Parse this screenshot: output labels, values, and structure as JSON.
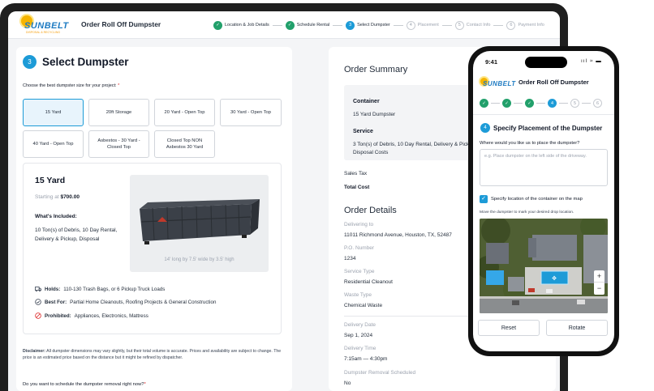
{
  "brand": {
    "name": "SUNBELT",
    "tagline": "DISPOSAL & RECYCLING"
  },
  "app_title": "Order Roll Off Dumpster",
  "steps": [
    {
      "num": "",
      "label": "Location & Job Details",
      "state": "done"
    },
    {
      "num": "",
      "label": "Schedule Rental",
      "state": "done"
    },
    {
      "num": "3",
      "label": "Select Dumpster",
      "state": "current"
    },
    {
      "num": "4",
      "label": "Placement",
      "state": "todo"
    },
    {
      "num": "5",
      "label": "Contact Info",
      "state": "todo"
    },
    {
      "num": "6",
      "label": "Payment Info",
      "state": "todo"
    }
  ],
  "select": {
    "step_num": "3",
    "title": "Select Dumpster",
    "prompt": "Choose the best dumpster size for your project:",
    "required_mark": "*",
    "options": [
      {
        "label": "15 Yard",
        "selected": true
      },
      {
        "label": "20ft Storage",
        "selected": false
      },
      {
        "label": "20 Yard - Open Top",
        "selected": false
      },
      {
        "label": "30 Yard - Open Top",
        "selected": false
      },
      {
        "label": "40 Yard - Open Top",
        "selected": false
      },
      {
        "label": "Asbestos - 30 Yard - Closed Top",
        "selected": false
      },
      {
        "label": "Closed Top NON Asbestos 30 Yard",
        "selected": false
      }
    ]
  },
  "detail": {
    "name": "15 Yard",
    "starting_prefix": "Starting at",
    "price": "$700.00",
    "included_heading": "What's Included:",
    "included_text": "10 Ton(s) of Debris, 10 Day Rental, Delivery & Pickup, Disposal",
    "dimensions": "14' long by 7.5' wide by 3.5' high",
    "holds_label": "Holds:",
    "holds_text": "110-130 Trash Bags, or 6 Pickup Truck Loads",
    "best_label": "Best For:",
    "best_text": "Partial Home Cleanouts, Roofing Projects & General Construction",
    "prohibited_label": "Prohibited:",
    "prohibited_text": "Appliances, Electronics, Mattress"
  },
  "disclaimer": {
    "label": "Disclaimer:",
    "text": "All dumpster dimensions may vary slightly, but their total volume is accurate. Prices and availability are subject to change. The price is an estimated price based on the distance but it might be refined by dispatcher."
  },
  "schedule_question": "Do you want to schedule the dumpster removal right now?",
  "order_summary": {
    "title": "Order Summary",
    "container_label": "Container",
    "container_value": "15 Yard Dumpster",
    "service_label": "Service",
    "service_value": "3 Ton(s) of Debris, 10 Day Rental, Delivery & Pickup, Disposal Costs",
    "sales_tax_label": "Sales Tax",
    "total_cost_label": "Total Cost"
  },
  "order_details": {
    "title": "Order Details",
    "rows": [
      {
        "label": "Delivering to",
        "value": "11011 Richmond Avenue, Houston, TX, 52487"
      },
      {
        "label": "P.O. Number",
        "value": "1234"
      },
      {
        "label": "Service Type",
        "value": "Residential Cleanout"
      },
      {
        "label": "Waste Type",
        "value": "Chemical Waste"
      },
      {
        "label": "Delivery Date",
        "value": "Sep 1, 2024"
      },
      {
        "label": "Delivery Time",
        "value": "7:15am — 4:30pm"
      },
      {
        "label": "Dumpster Removal Scheduled",
        "value": "No"
      }
    ]
  },
  "phone": {
    "time": "9:41",
    "status": "ııl ≈ ▬",
    "title": "Order Roll Off Dumpster",
    "steps": [
      {
        "num": "",
        "state": "done"
      },
      {
        "num": "",
        "state": "done"
      },
      {
        "num": "",
        "state": "done"
      },
      {
        "num": "4",
        "state": "current"
      },
      {
        "num": "5",
        "state": "todo"
      },
      {
        "num": "6",
        "state": "todo"
      }
    ],
    "section_num": "4",
    "section_title": "Specify Placement of the Dumpster",
    "question": "Where would you like us to place the dumpster?",
    "placeholder": "e.g. Place dumpster on the left side of the driveway.",
    "checkbox_label": "Specify location of the container on the map",
    "map_note": "Move the dumpster to mark your desired drop location.",
    "zoom_in": "+",
    "zoom_out": "−",
    "reset_label": "Reset",
    "rotate_label": "Rotate"
  },
  "colors": {
    "accent": "#1d9bd7",
    "success": "#22a06b",
    "danger": "#dc2626",
    "brand_blue": "#1e7bc2",
    "brand_yellow": "#f5b400"
  }
}
